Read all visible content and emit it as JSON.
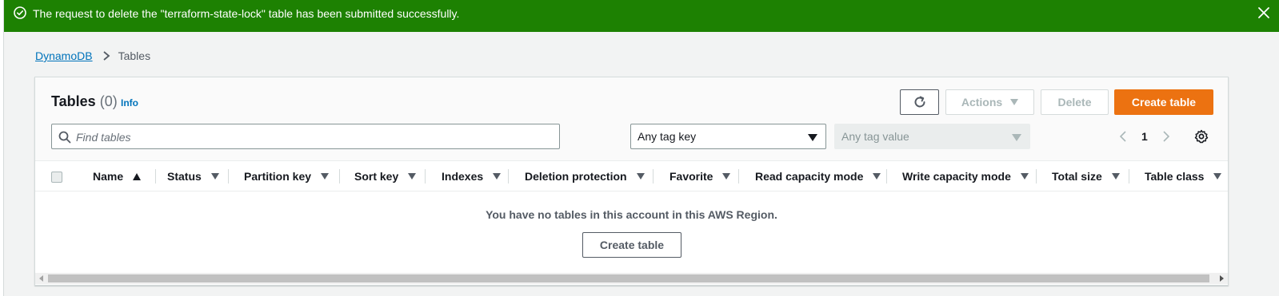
{
  "flash": {
    "message": "The request to delete the \"terraform-state-lock\" table has been submitted successfully.",
    "icon": "success-circle-icon",
    "color": "#1d8102"
  },
  "breadcrumb": {
    "root": "DynamoDB",
    "current": "Tables"
  },
  "panel": {
    "title": "Tables",
    "count": "(0)",
    "info_label": "Info"
  },
  "toolbar": {
    "refresh_icon": "refresh-icon",
    "actions_label": "Actions",
    "delete_label": "Delete",
    "create_label": "Create table",
    "accent": "#ec7211"
  },
  "filters": {
    "search_placeholder": "Find tables",
    "tag_key": "Any tag key",
    "tag_value": "Any tag value"
  },
  "pagination": {
    "page": "1"
  },
  "columns": [
    "Name",
    "Status",
    "Partition key",
    "Sort key",
    "Indexes",
    "Deletion protection",
    "Favorite",
    "Read capacity mode",
    "Write capacity mode",
    "Total size",
    "Table class"
  ],
  "empty": {
    "message": "You have no tables in this account in this AWS Region.",
    "button": "Create table"
  }
}
